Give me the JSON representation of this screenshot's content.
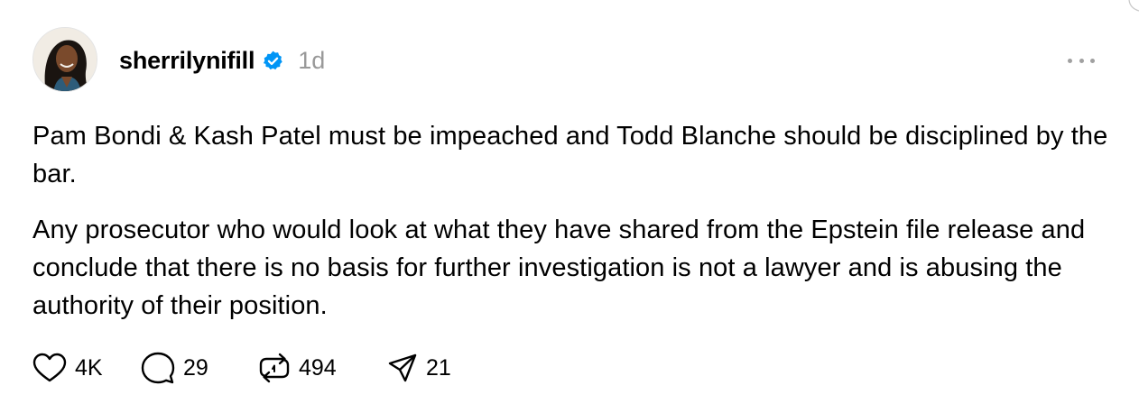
{
  "post": {
    "username": "sherrilynifill",
    "verified_icon": "verified-badge-icon",
    "timestamp": "1d",
    "paragraphs": [
      "Pam Bondi & Kash Patel must be impeached and Todd Blanche should be disciplined by the bar.",
      "Any prosecutor who would look at what they have shared from the Epstein file release and conclude that there is no basis for further investigation is not a lawyer and is abusing the authority of their position."
    ],
    "actions": {
      "like_count": "4K",
      "reply_count": "29",
      "repost_count": "494",
      "share_count": "21"
    }
  },
  "icons": {
    "avatar": "profile-photo",
    "like": "heart-icon",
    "reply": "comment-bubble-icon",
    "repost": "repost-icon",
    "share": "send-icon",
    "more": "more-options-icon"
  },
  "colors": {
    "verified": "#0095f6",
    "muted_text": "#999999",
    "icon": "#000000"
  }
}
